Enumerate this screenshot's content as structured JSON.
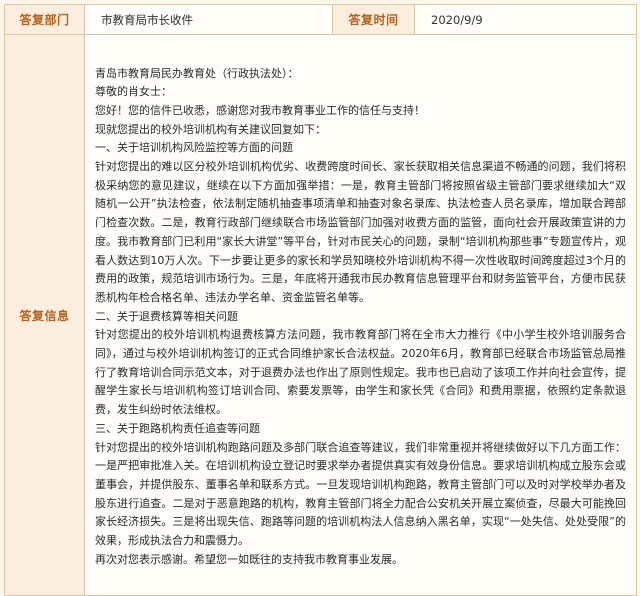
{
  "header": {
    "department_label": "答复部门",
    "department_value": "市教育局市长收件",
    "time_label": "答复时间",
    "time_value": "2020/9/9"
  },
  "reply": {
    "label": "答复信息",
    "paragraphs": [
      "青岛市教育局民办教育处（行政执法处）：",
      "尊敬的肖女士：",
      "您好！您的信件已收悉，感谢您对我市教育事业工作的信任与支持！",
      "现就您提出的校外培训机构有关建议回复如下：",
      "一、关于培训机构风险监控等方面的问题",
      "针对您提出的难以区分校外培训机构优劣、收费跨度时间长、家长获取相关信息渠道不畅通的问题，我们将积极采纳您的意见建议，继续在以下方面加强举措：一是，教育主管部门将按照省级主管部门要求继续加大“双随机一公开”执法检查，依法制定随机抽查事项清单和抽查对象名录库、执法检查人员名录库，增加联合跨部门检查次数。二是，教育行政部门继续联合市场监管部门加强对收费方面的监管，面向社会开展政策宣讲的力度。我市教育部门已利用“家长大讲堂”等平台，针对市民关心的问题，录制“培训机构那些事”专题宣传片，观看人数达到10万人次。下一步要让更多的家长和学员知晓校外培训机构不得一次性收取时间跨度超过3个月的费用的政策，规范培训市场行为。三是，年底将开通我市民办教育信息管理平台和财务监管平台，方便市民获悉机构年检合格名单、违法办学名单、资金监管名单等。",
      "二、关于退费核算等相关问题",
      "针对您提出的校外培训机构退费核算方法问题，我市教育部门将在全市大力推行《中小学生校外培训服务合同》，通过与校外培训机构签订的正式合同维护家长合法权益。2020年6月，教育部已经联合市场监管总局推行了教育培训合同示范文本，对于退费办法也作出了原则性规定。我市也已启动了该项工作并向社会宣传，提醒学生家长与培训机构签订培训合同、索要发票等，由学生和家长凭《合同》和费用票据，依照约定条款退费，发生纠纷时依法维权。",
      "三、关于跑路机构责任追查等问题",
      "针对您提出的校外培训机构跑路问题及多部门联合追查等建议，我们非常重视并将继续做好以下几方面工作：一是严把审批准入关。在培训机构设立登记时要求举办者提供真实有效身份信息。要求培训机构成立股东会或董事会，并提供股东、董事名单和联系方式。一旦发现培训机构跑路，教育主管部门可以及时对学校举办者及股东进行追查。二是对于恶意跑路的机构，教育主管部门将全力配合公安机关开展立案侦查，尽最大可能挽回家长经济损失。三是将出现失信、跑路等问题的培训机构法人信息纳入黑名单，实现“一处失信、处处受限”的效果，形成执法合力和震慑力。",
      "再次对您表示感谢。希望您一如既往的支持我市教育事业发展。"
    ]
  }
}
